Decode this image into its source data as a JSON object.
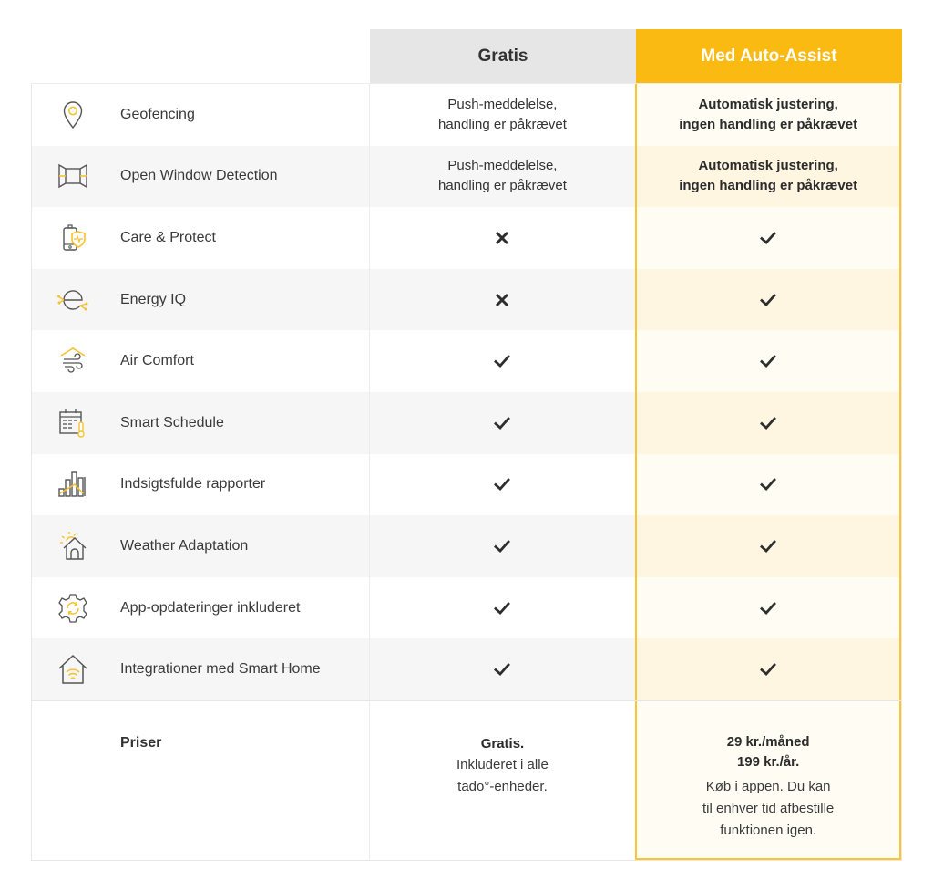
{
  "columns": {
    "free": "Gratis",
    "premium": "Med Auto-Assist"
  },
  "colors": {
    "accent": "#fbba12",
    "free_header_bg": "#e6e6e6",
    "icon_stroke": "#555555",
    "icon_accent": "#f6c22d"
  },
  "features": [
    {
      "label": "Geofencing",
      "icon": "location-pin-icon",
      "free": {
        "type": "text",
        "text1": "Push-meddelelse,",
        "text2": "handling er påkrævet"
      },
      "premium": {
        "type": "text",
        "text1": "Automatisk justering,",
        "text2": "ingen handling er påkrævet"
      }
    },
    {
      "label": "Open Window Detection",
      "icon": "open-window-icon",
      "free": {
        "type": "text",
        "text1": "Push-meddelelse,",
        "text2": "handling er påkrævet"
      },
      "premium": {
        "type": "text",
        "text1": "Automatisk justering,",
        "text2": "ingen handling er påkrævet"
      }
    },
    {
      "label": "Care & Protect",
      "icon": "device-shield-icon",
      "free": {
        "type": "cross"
      },
      "premium": {
        "type": "check"
      }
    },
    {
      "label": "Energy IQ",
      "icon": "energy-iq-icon",
      "free": {
        "type": "cross"
      },
      "premium": {
        "type": "check"
      }
    },
    {
      "label": "Air Comfort",
      "icon": "air-comfort-icon",
      "free": {
        "type": "check"
      },
      "premium": {
        "type": "check"
      }
    },
    {
      "label": "Smart Schedule",
      "icon": "calendar-thermometer-icon",
      "free": {
        "type": "check"
      },
      "premium": {
        "type": "check"
      }
    },
    {
      "label": "Indsigtsfulde rapporter",
      "icon": "bar-chart-icon",
      "free": {
        "type": "check"
      },
      "premium": {
        "type": "check"
      }
    },
    {
      "label": "Weather Adaptation",
      "icon": "sun-house-icon",
      "free": {
        "type": "check"
      },
      "premium": {
        "type": "check"
      }
    },
    {
      "label": "App-opdateringer inkluderet",
      "icon": "gear-refresh-icon",
      "free": {
        "type": "check"
      },
      "premium": {
        "type": "check"
      }
    },
    {
      "label": "Integrationer med Smart Home",
      "icon": "smart-home-wifi-icon",
      "free": {
        "type": "check"
      },
      "premium": {
        "type": "check"
      }
    }
  ],
  "pricing": {
    "label": "Priser",
    "free": {
      "title": "Gratis.",
      "line1": "Inkluderet i alle",
      "line2": "tado°-enheder."
    },
    "premium": {
      "monthly": "29 kr./måned",
      "yearly": "199 kr./år.",
      "line1": "Køb i appen. Du kan",
      "line2": "til enhver tid afbestille",
      "line3": "funktionen igen."
    }
  }
}
